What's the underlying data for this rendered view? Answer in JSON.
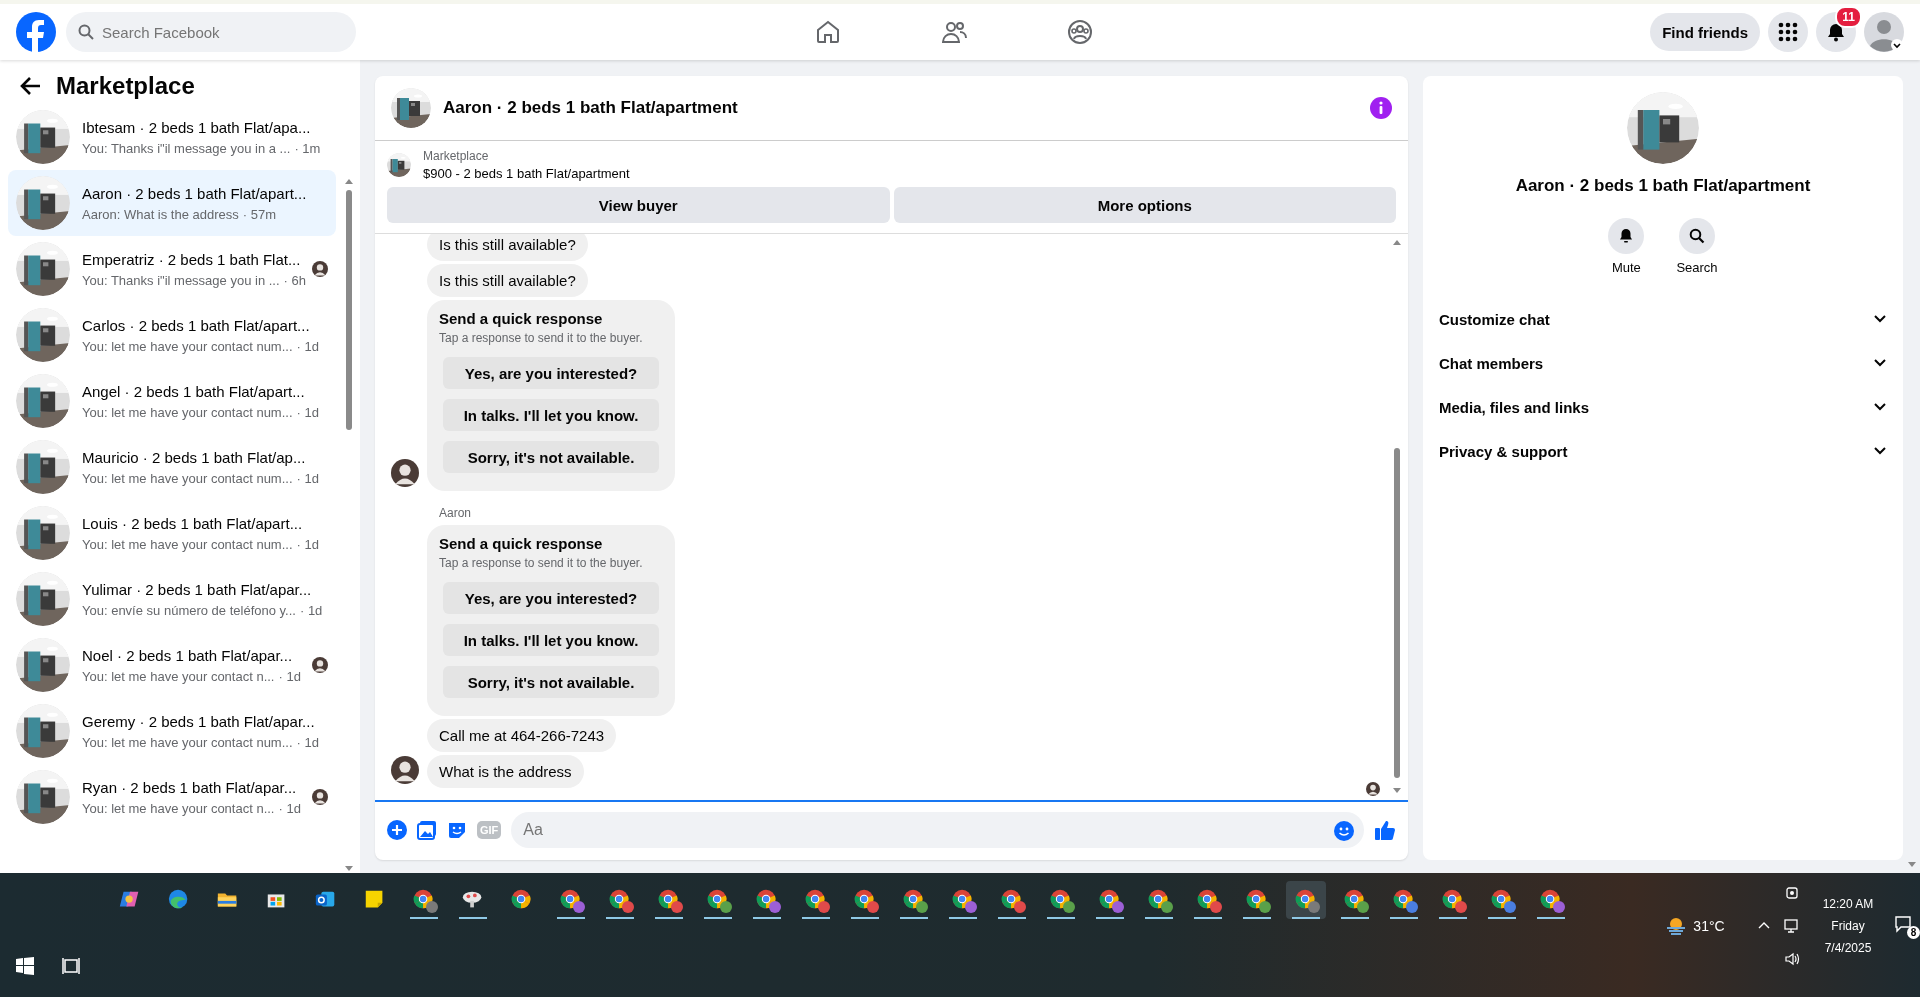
{
  "topbar": {
    "search": {
      "placeholder": "Search Facebook"
    },
    "nav": [
      {
        "kind": "home",
        "selected": false
      },
      {
        "kind": "friends",
        "selected": false
      },
      {
        "kind": "groups",
        "selected": false
      }
    ],
    "find_friends": "Find friends",
    "notifications_badge": "11"
  },
  "sidebar": {
    "title": "Marketplace",
    "conversations": [
      {
        "title": "Ibtesam · 2 beds 1 bath Flat/apa...",
        "preview": "You: Thanks i\"il message you in a ...",
        "time": "· 1m",
        "selected": false,
        "seen": false
      },
      {
        "title": "Aaron · 2 beds 1 bath Flat/apart...",
        "preview": "Aaron: What is the address",
        "time": "· 57m",
        "selected": true,
        "seen": false
      },
      {
        "title": "Emperatriz · 2 beds 1 bath Flat...",
        "preview": "You: Thanks i\"il message you in ...",
        "time": "· 6h",
        "selected": false,
        "seen": true
      },
      {
        "title": "Carlos · 2 beds 1 bath Flat/apart...",
        "preview": "You: let me have your contact num...",
        "time": "· 1d",
        "selected": false,
        "seen": false
      },
      {
        "title": "Angel · 2 beds 1 bath Flat/apart...",
        "preview": "You: let me have your contact num...",
        "time": "· 1d",
        "selected": false,
        "seen": false
      },
      {
        "title": "Mauricio · 2 beds 1 bath Flat/ap...",
        "preview": "You: let me have your contact num...",
        "time": "· 1d",
        "selected": false,
        "seen": false
      },
      {
        "title": "Louis · 2 beds 1 bath Flat/apart...",
        "preview": "You: let me have your contact num...",
        "time": "· 1d",
        "selected": false,
        "seen": false
      },
      {
        "title": "Yulimar · 2 beds 1 bath Flat/apar...",
        "preview": "You: envíe su número de teléfono y...",
        "time": "· 1d",
        "selected": false,
        "seen": false
      },
      {
        "title": "Noel · 2 beds 1 bath Flat/apar...",
        "preview": "You: let me have your contact n...",
        "time": "· 1d",
        "selected": false,
        "seen": true
      },
      {
        "title": "Geremy · 2 beds 1 bath Flat/apar...",
        "preview": "You: let me have your contact num...",
        "time": "· 1d",
        "selected": false,
        "seen": false
      },
      {
        "title": "Ryan · 2 beds 1 bath Flat/apar...",
        "preview": "You: let me have your contact n...",
        "time": "· 1d",
        "selected": false,
        "seen": true
      }
    ]
  },
  "chat": {
    "title": "Aaron · 2 beds 1 bath Flat/apartment",
    "listing": {
      "source": "Marketplace",
      "price_title": "$900 - 2 beds 1 bath Flat/apartment"
    },
    "buttons": [
      "View buyer",
      "More options"
    ],
    "messages": [
      {
        "kind": "text",
        "text": "Is this still available?",
        "avatar": false
      },
      {
        "kind": "text",
        "text": "Is this still available?",
        "avatar": false
      },
      {
        "kind": "quick",
        "title": "Send a quick response",
        "subtitle": "Tap a response to send it to the buyer.",
        "options": [
          "Yes, are you interested?",
          "In talks. I'll let you know.",
          "Sorry, it's not available."
        ],
        "avatar": true
      },
      {
        "kind": "sender",
        "text": "Aaron"
      },
      {
        "kind": "quick",
        "title": "Send a quick response",
        "subtitle": "Tap a response to send it to the buyer.",
        "options": [
          "Yes, are you interested?",
          "In talks. I'll let you know.",
          "Sorry, it's not available."
        ],
        "avatar": false
      },
      {
        "kind": "text",
        "text": "Call me at 464-266-7243",
        "avatar": false
      },
      {
        "kind": "text",
        "text": "What is the address",
        "avatar": true
      }
    ],
    "composer": {
      "gif": "GIF",
      "placeholder": "Aa"
    }
  },
  "info": {
    "title": "Aaron · 2 beds 1 bath Flat/apartment",
    "actions": [
      {
        "kind": "mute",
        "label": "Mute"
      },
      {
        "kind": "search",
        "label": "Search"
      }
    ],
    "sections": [
      {
        "label": "Customize chat",
        "expanded": false
      },
      {
        "label": "Chat members",
        "expanded": false
      },
      {
        "label": "Media, files and links",
        "expanded": false
      },
      {
        "label": "Privacy & support",
        "expanded": false
      }
    ]
  },
  "taskbar": {
    "apps": [
      {
        "kind": "copilot",
        "running": false,
        "selected": false
      },
      {
        "kind": "edge",
        "running": false,
        "selected": false
      },
      {
        "kind": "explorer",
        "running": false,
        "selected": false
      },
      {
        "kind": "store",
        "running": false,
        "selected": false
      },
      {
        "kind": "outlook",
        "running": false,
        "selected": false
      },
      {
        "kind": "notes",
        "running": false,
        "selected": false
      },
      {
        "kind": "chrome",
        "color": "#7a7a7a",
        "running": true,
        "selected": false
      },
      {
        "kind": "app",
        "running": true,
        "selected": false
      },
      {
        "kind": "chrome",
        "running": false,
        "selected": false
      },
      {
        "kind": "chrome",
        "color": "#9c5fd6",
        "running": true,
        "selected": false
      },
      {
        "kind": "chrome",
        "color": "#e04a4a",
        "running": true,
        "selected": false
      },
      {
        "kind": "chrome",
        "color": "#e04a4a",
        "running": true,
        "selected": false
      },
      {
        "kind": "chrome",
        "color": "#5aa04a",
        "running": true,
        "selected": false
      },
      {
        "kind": "chrome",
        "color": "#9c5fd6",
        "running": true,
        "selected": false
      },
      {
        "kind": "chrome",
        "color": "#e04a4a",
        "running": true,
        "selected": false
      },
      {
        "kind": "chrome",
        "color": "#e04a4a",
        "running": true,
        "selected": false
      },
      {
        "kind": "chrome",
        "color": "#5aa04a",
        "running": true,
        "selected": false
      },
      {
        "kind": "chrome",
        "color": "#9c5fd6",
        "running": true,
        "selected": false
      },
      {
        "kind": "chrome",
        "color": "#e04a4a",
        "running": true,
        "selected": false
      },
      {
        "kind": "chrome",
        "color": "#5aa04a",
        "running": true,
        "selected": false
      },
      {
        "kind": "chrome",
        "color": "#9c5fd6",
        "running": true,
        "selected": false
      },
      {
        "kind": "chrome",
        "color": "#5aa04a",
        "running": true,
        "selected": false
      },
      {
        "kind": "chrome",
        "color": "#e04a4a",
        "running": true,
        "selected": false
      },
      {
        "kind": "chrome",
        "color": "#5aa04a",
        "running": true,
        "selected": false
      },
      {
        "kind": "chrome",
        "color": "#7a7a7a",
        "running": true,
        "selected": true
      },
      {
        "kind": "chrome",
        "color": "#5aa04a",
        "running": true,
        "selected": false
      },
      {
        "kind": "chrome",
        "color": "#4a7ee0",
        "running": true,
        "selected": false
      },
      {
        "kind": "chrome",
        "color": "#e04a4a",
        "running": true,
        "selected": false
      },
      {
        "kind": "chrome",
        "color": "#4a7ee0",
        "running": true,
        "selected": false
      },
      {
        "kind": "chrome",
        "color": "#9c5fd6",
        "running": true,
        "selected": false
      }
    ],
    "weather": "31°C",
    "time": "12:20 AM",
    "day": "Friday",
    "date": "7/4/2025",
    "notifications": "8"
  }
}
